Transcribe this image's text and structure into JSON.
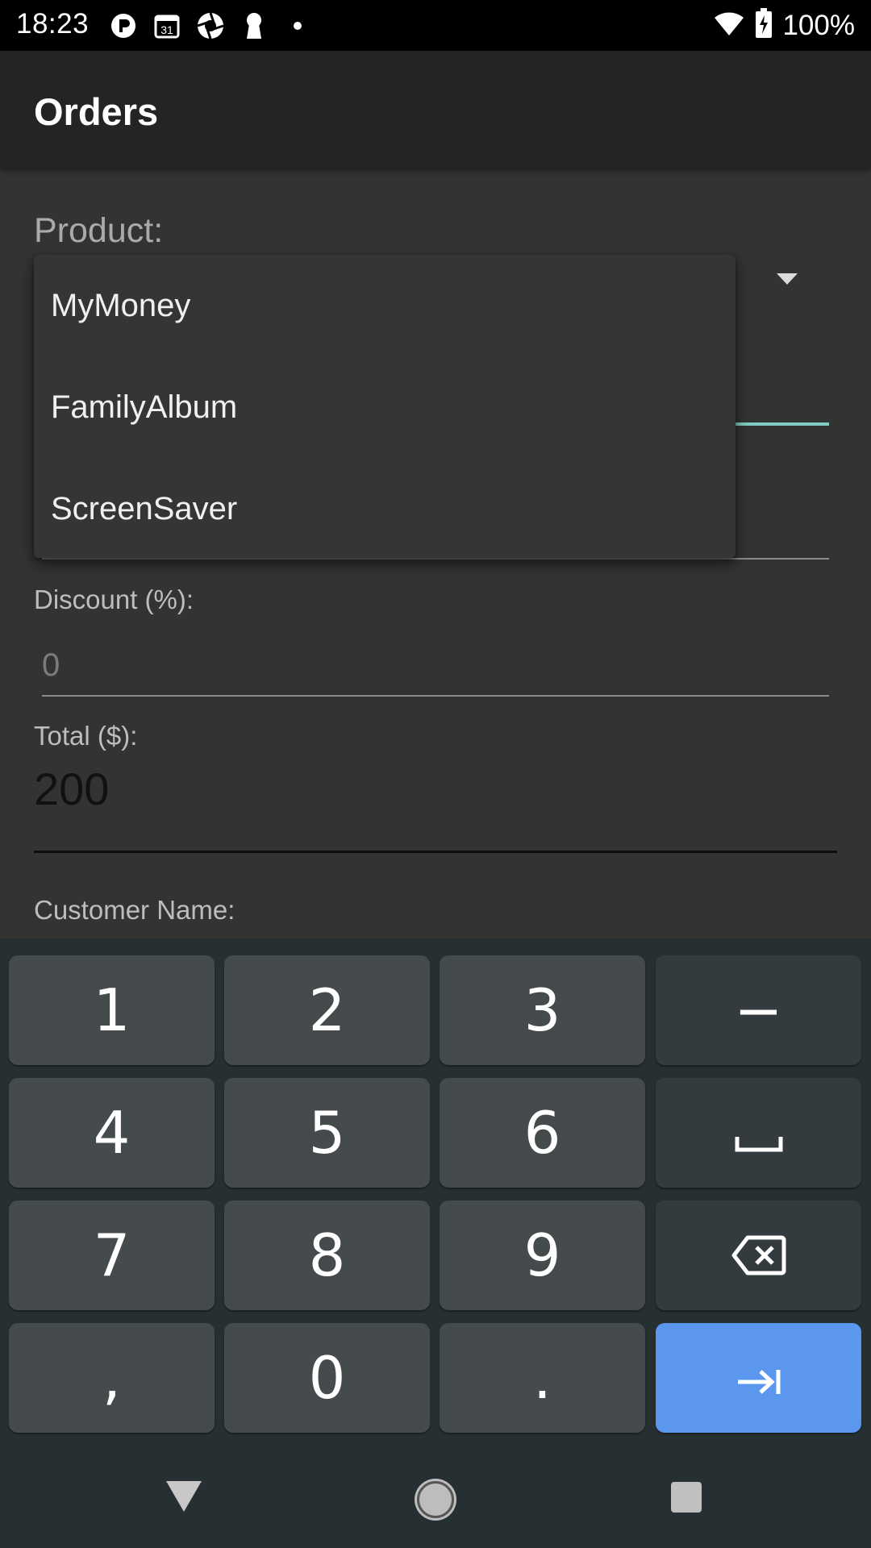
{
  "status_bar": {
    "time": "18:23",
    "calendar_day": "31",
    "battery_pct": "100%",
    "icons": [
      "p-app-icon",
      "calendar-icon",
      "aperture-icon",
      "keyhole-icon",
      "dot-icon",
      "wifi-icon",
      "battery-icon"
    ]
  },
  "app_bar": {
    "title": "Orders"
  },
  "form": {
    "product_label": "Product:",
    "discount_label": "Discount (%):",
    "discount_value": "0",
    "total_label": "Total ($):",
    "total_value": "200",
    "customer_label": "Customer Name:"
  },
  "dropdown": {
    "options": [
      "MyMoney",
      "FamilyAlbum",
      "ScreenSaver"
    ]
  },
  "keyboard": {
    "keys": {
      "k1": "1",
      "k2": "2",
      "k3": "3",
      "minus": "−",
      "k4": "4",
      "k5": "5",
      "k6": "6",
      "space": "␣",
      "k7": "7",
      "k8": "8",
      "k9": "9",
      "backspace": "⌫",
      "comma": ",",
      "k0": "0",
      "period": ".",
      "enter": "⇥"
    },
    "colors": {
      "key_bg": "#454b4c",
      "fn_bg": "#333b3e",
      "enter_bg": "#5b97ef"
    }
  },
  "colors": {
    "accent": "#7fcdc2",
    "app_bar": "#232523",
    "background": "#323432"
  }
}
